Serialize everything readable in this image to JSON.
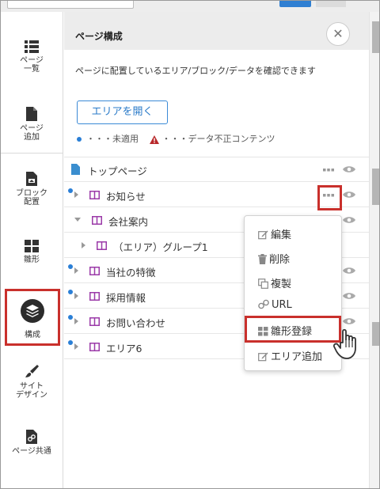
{
  "sidebar": {
    "items": [
      {
        "label": "ページ\n一覧",
        "icon": "list-icon"
      },
      {
        "label": "ページ\n追加",
        "icon": "file-icon"
      },
      {
        "label": "ブロック\n配置",
        "icon": "block-place-icon"
      },
      {
        "label": "雛形",
        "icon": "template-grid-icon"
      },
      {
        "label": "構成",
        "icon": "layers-icon"
      },
      {
        "label": "サイト\nデザイン",
        "icon": "brush-icon"
      },
      {
        "label": "ページ共通",
        "icon": "link-file-icon"
      }
    ]
  },
  "panel": {
    "title": "ページ構成",
    "description": "ページに配置しているエリア/ブロック/データを確認できます",
    "open_area_button": "エリアを開く",
    "legend_unapplied": "・・・未適用",
    "legend_invalid": "・・・データ不正コンテンツ"
  },
  "tree": {
    "rows": [
      {
        "label": "トップページ"
      },
      {
        "label": "お知らせ"
      },
      {
        "label": "会社案内"
      },
      {
        "label": "（エリア）グループ1"
      },
      {
        "label": "当社の特徴"
      },
      {
        "label": "採用情報"
      },
      {
        "label": "お問い合わせ"
      },
      {
        "label": "エリア6"
      }
    ]
  },
  "context_menu": {
    "items": [
      {
        "label": "編集",
        "icon": "edit-icon"
      },
      {
        "label": "削除",
        "icon": "trash-icon"
      },
      {
        "label": "複製",
        "icon": "copy-icon"
      },
      {
        "label": "URL",
        "icon": "link-icon"
      },
      {
        "label": "雛形登録",
        "icon": "template-grid-icon"
      },
      {
        "label": "エリア追加",
        "icon": "edit-icon"
      }
    ]
  },
  "colors": {
    "accent_blue": "#2a7fd6",
    "highlight_red": "#c9302c",
    "area_icon_purple": "#9b3aa8",
    "page_icon_blue": "#3a8ecf"
  }
}
